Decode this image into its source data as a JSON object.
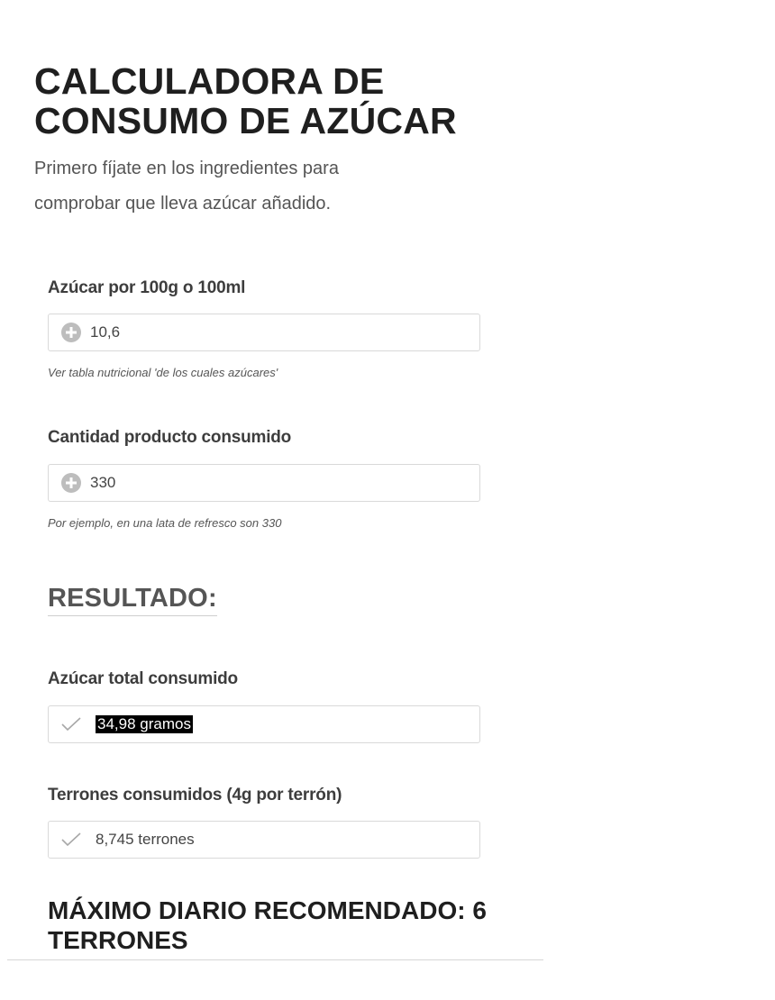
{
  "page": {
    "title": "CALCULADORA DE CONSUMO DE AZÚCAR",
    "intro": "Primero fíjate en los ingredientes para comprobar que lleva azúcar añadido."
  },
  "inputs": {
    "sugar_per_100": {
      "label": "Azúcar por 100g o 100ml",
      "value": "10,6",
      "hint": "Ver tabla nutricional 'de los cuales azúcares'",
      "icon": "plus-icon"
    },
    "amount_consumed": {
      "label": "Cantidad producto consumido",
      "value": "330",
      "hint": "Por ejemplo, en una lata de refresco son 330",
      "icon": "plus-icon"
    }
  },
  "results": {
    "heading": "RESULTADO:",
    "total_sugar": {
      "label": "Azúcar total consumido",
      "value": "34,98 gramos",
      "icon": "check-icon"
    },
    "cubes": {
      "label": "Terrones consumidos (4g por terrón)",
      "value": "8,745 terrones",
      "icon": "check-icon"
    }
  },
  "recommendation": {
    "text": "MÁXIMO DIARIO RECOMENDADO: 6 TERRONES"
  }
}
